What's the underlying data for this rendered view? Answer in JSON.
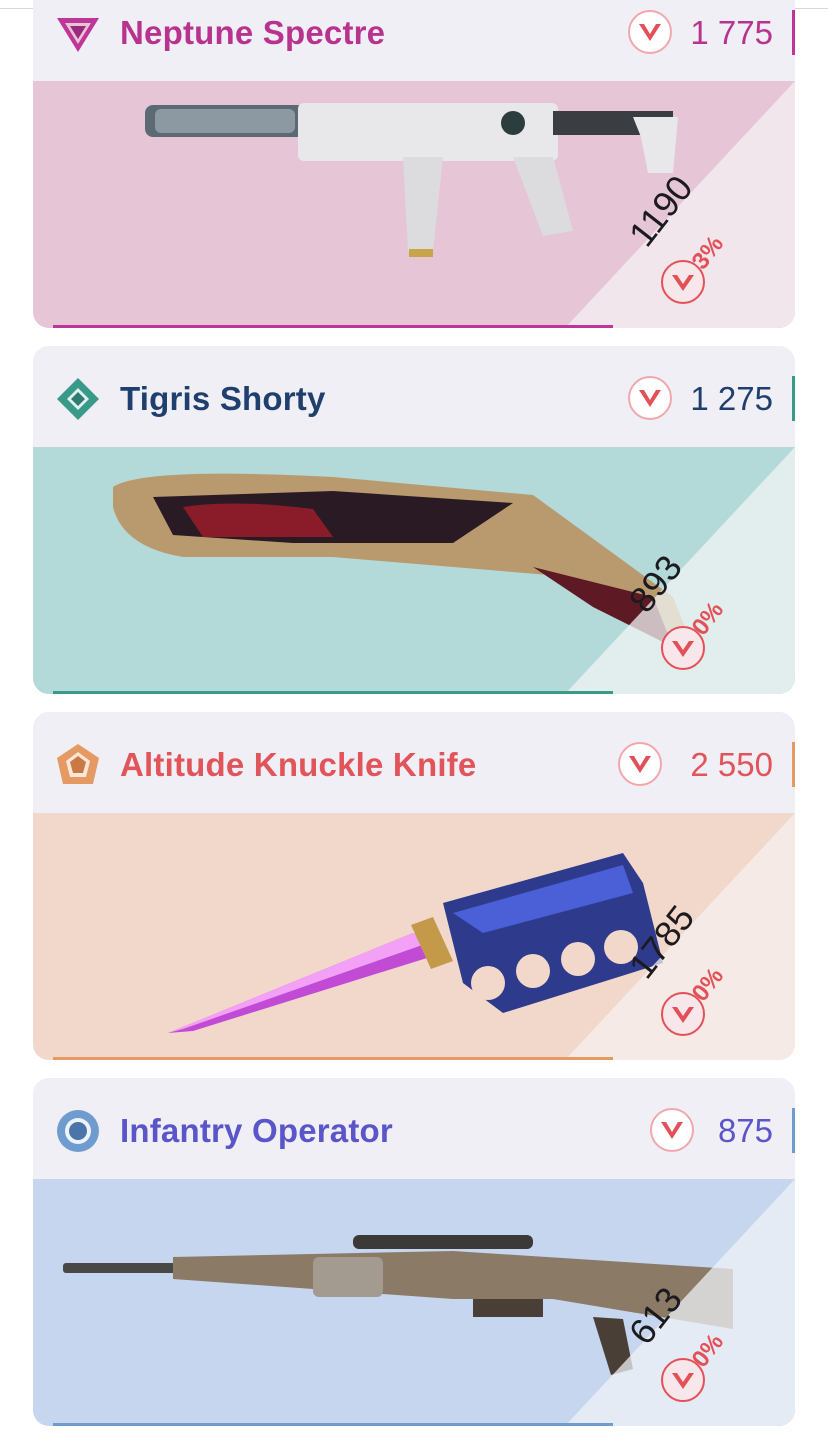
{
  "cards": [
    {
      "name": "Neptune Spectre",
      "price": "1 775",
      "sale_price": "1190",
      "discount": "-33%",
      "tier_icon": "triangle-tier-icon",
      "accent": "#c0359a",
      "name_color": "#b8338e",
      "art_bg": "#e6c5d6"
    },
    {
      "name": "Tigris Shorty",
      "price": "1 275",
      "sale_price": "893",
      "discount": "-30%",
      "tier_icon": "diamond-tier-icon",
      "accent": "#3a9a8a",
      "name_color": "#1f3f6e",
      "art_bg": "#b3d9d8"
    },
    {
      "name": "Altitude Knuckle Knife",
      "price": "2 550",
      "sale_price": "1785",
      "discount": "-30%",
      "tier_icon": "pentagon-tier-icon",
      "accent": "#e59a63",
      "name_color": "#e1545a",
      "art_bg": "#f1d8ca"
    },
    {
      "name": "Infantry Operator",
      "price": "875",
      "sale_price": "613",
      "discount": "-30%",
      "tier_icon": "circle-tier-icon",
      "accent": "#6f9ccf",
      "name_color": "#5a55c8",
      "art_bg": "#c6d6ee"
    }
  ]
}
